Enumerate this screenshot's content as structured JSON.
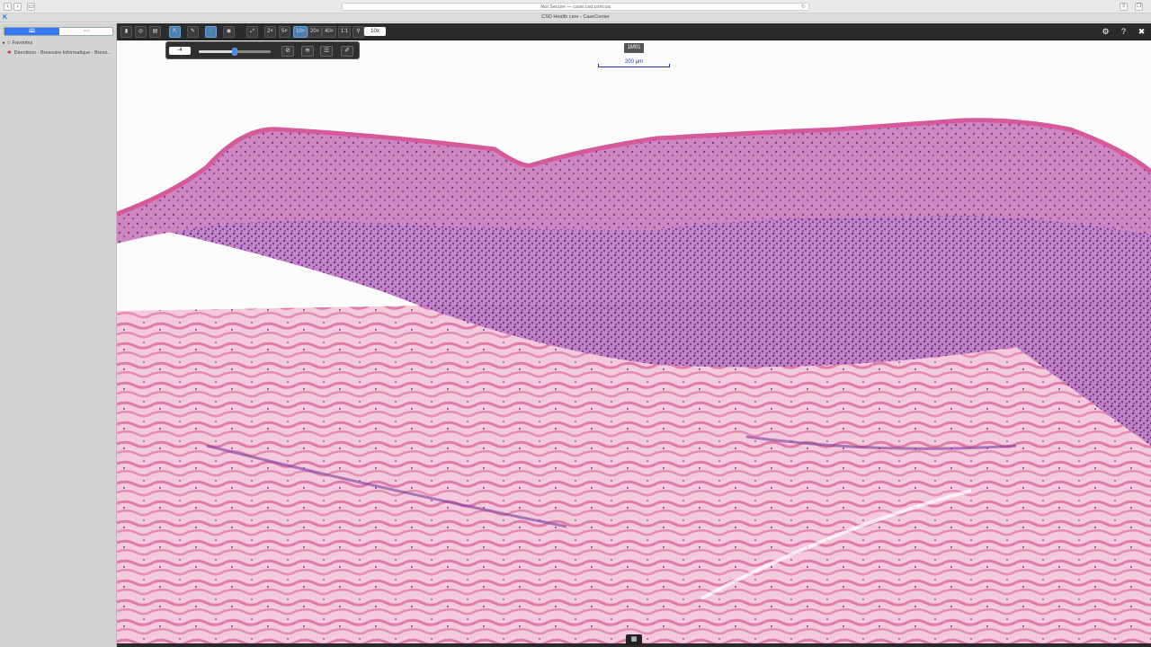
{
  "browser": {
    "address": "Not Secure — case.csd.com.ua",
    "page_title": "CSD Health care - CaseCenter",
    "back_glyph": "‹",
    "forward_glyph": "›",
    "sidebar_toggle_glyph": "▭",
    "reload_glyph": "↻",
    "share_glyph": "⇧",
    "tabs_glyph": "❐",
    "app_glyph": "K"
  },
  "sidebar": {
    "seg_left": "🕮",
    "seg_right": "○○",
    "favorites_label": "Favorites",
    "favorites_item": "Directions - Bressuire Informatique - Bress..."
  },
  "viewer": {
    "slide_label": "1M01",
    "scalebar_text": "200 µm",
    "zoom_levels": [
      "2×",
      "5×",
      "10×",
      "20×",
      "40×"
    ],
    "ratio_label": "1:1",
    "zoom_value": "10x",
    "subpanel_value": "-4",
    "bottom_handle": "▦",
    "subpanel_level": 0.5
  },
  "tools": {
    "toggle_panel_glyph": "▮",
    "navigate_glyph": "◎",
    "thumbnail_glyph": "▤",
    "pointer_glyph": "⇱",
    "annotate_glyph": "✎",
    "adjust_glyph": "◌",
    "snapshot_glyph": "◉",
    "fullscreen_glyph": "⤢",
    "zoom_glyph": "⚲",
    "settings_glyph": "⚙",
    "help_glyph": "?",
    "close_glyph": "✖",
    "reset_glyph": "⊘",
    "layers_glyph": "≋",
    "filters_glyph": "☰",
    "pin_glyph": "✐"
  },
  "colors": {
    "toolbar": "#2b2b2b",
    "active_tool": "#4a7fb3",
    "scalebar": "#2233bb",
    "epidermis": "#b0408e",
    "dermis": "#e8a4c4",
    "infiltrate": "#8a4aa8"
  }
}
